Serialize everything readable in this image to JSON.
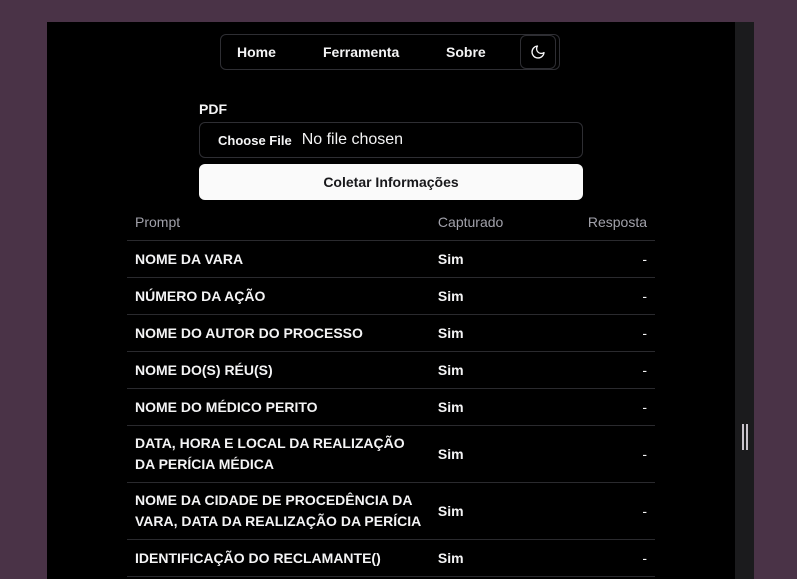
{
  "nav": {
    "home": "Home",
    "tool": "Ferramenta",
    "about": "Sobre",
    "theme_icon": "moon-icon"
  },
  "form": {
    "pdf_label": "PDF",
    "file_button": "Choose File",
    "file_status": "No file chosen",
    "submit": "Coletar Informações"
  },
  "table": {
    "headers": [
      "Prompt",
      "Capturado",
      "Resposta"
    ],
    "rows": [
      {
        "prompt": "NOME DA VARA",
        "captured": "Sim",
        "response": "-"
      },
      {
        "prompt": "NÚMERO DA AÇÃO",
        "captured": "Sim",
        "response": "-"
      },
      {
        "prompt": "NOME DO AUTOR DO PROCESSO",
        "captured": "Sim",
        "response": "-"
      },
      {
        "prompt": "NOME DO(S) RÉU(S)",
        "captured": "Sim",
        "response": "-"
      },
      {
        "prompt": "NOME DO MÉDICO PERITO",
        "captured": "Sim",
        "response": "-"
      },
      {
        "prompt": "DATA, HORA E LOCAL DA REALIZAÇÃO DA PERÍCIA MÉDICA",
        "captured": "Sim",
        "response": "-"
      },
      {
        "prompt": "NOME DA CIDADE DE PROCEDÊNCIA DA VARA, DATA DA REALIZAÇÃO DA PERÍCIA",
        "captured": "Sim",
        "response": "-"
      },
      {
        "prompt": "IDENTIFICAÇÃO DO RECLAMANTE()",
        "captured": "Sim",
        "response": "-"
      }
    ]
  }
}
